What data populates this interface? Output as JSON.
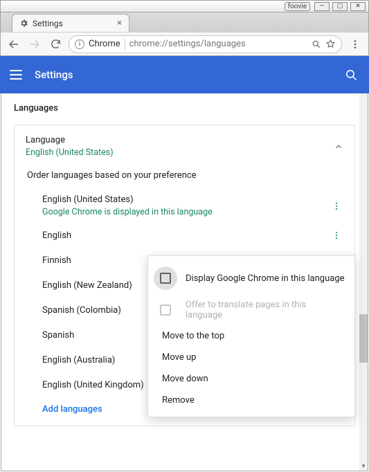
{
  "window": {
    "badge": "foovie"
  },
  "tab": {
    "title": "Settings"
  },
  "address": {
    "scheme": "Chrome",
    "url": "chrome://settings/languages"
  },
  "header": {
    "title": "Settings"
  },
  "section": {
    "heading": "Languages"
  },
  "language_card": {
    "title": "Language",
    "current": "English (United States)",
    "order_note": "Order languages based on your preference"
  },
  "languages": [
    {
      "name": "English (United States)",
      "note": "Google Chrome is displayed in this language"
    },
    {
      "name": "English"
    },
    {
      "name": "Finnish"
    },
    {
      "name": "English (New Zealand)"
    },
    {
      "name": "Spanish (Colombia)"
    },
    {
      "name": "Spanish"
    },
    {
      "name": "English (Australia)"
    },
    {
      "name": "English (United Kingdom)"
    }
  ],
  "add_languages": "Add languages",
  "menu": {
    "display": "Display Google Chrome in this language",
    "translate": "Offer to translate pages in this language",
    "move_top": "Move to the top",
    "move_up": "Move up",
    "move_down": "Move down",
    "remove": "Remove"
  }
}
